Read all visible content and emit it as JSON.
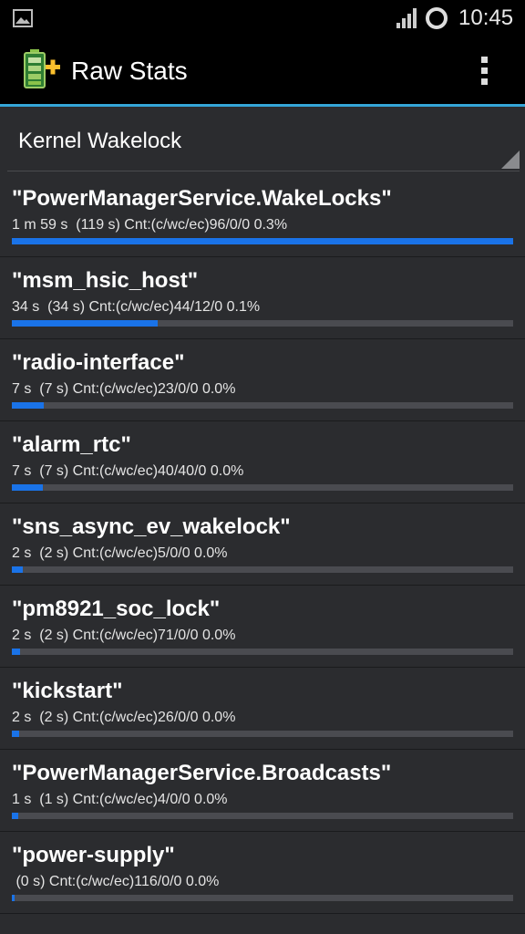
{
  "status_bar": {
    "time": "10:45",
    "icons": [
      "image-notification-icon",
      "signal-icon",
      "sync-ring-icon"
    ]
  },
  "action_bar": {
    "title": "Raw Stats",
    "app_icon": "battery-plus-icon",
    "menu_icon": "overflow-menu-icon"
  },
  "spinner": {
    "selected": "Kernel Wakelock"
  },
  "colors": {
    "accent": "#35a6d8",
    "bar_fill": "#1a73e8",
    "bar_track": "#4a4b50",
    "background": "#2b2c2f"
  },
  "wakelocks": [
    {
      "name": "\"PowerManagerService.WakeLocks\"",
      "detail": "1 m 59 s  (119 s) Cnt:(c/wc/ec)96/0/0 0.3%",
      "progress": 1.0
    },
    {
      "name": "\"msm_hsic_host\"",
      "detail": "34 s  (34 s) Cnt:(c/wc/ec)44/12/0 0.1%",
      "progress": 0.29
    },
    {
      "name": "\"radio-interface\"",
      "detail": "7 s  (7 s) Cnt:(c/wc/ec)23/0/0 0.0%",
      "progress": 0.063
    },
    {
      "name": "\"alarm_rtc\"",
      "detail": "7 s  (7 s) Cnt:(c/wc/ec)40/40/0 0.0%",
      "progress": 0.061
    },
    {
      "name": "\"sns_async_ev_wakelock\"",
      "detail": "2 s  (2 s) Cnt:(c/wc/ec)5/0/0 0.0%",
      "progress": 0.021
    },
    {
      "name": "\"pm8921_soc_lock\"",
      "detail": "2 s  (2 s) Cnt:(c/wc/ec)71/0/0 0.0%",
      "progress": 0.017
    },
    {
      "name": "\"kickstart\"",
      "detail": "2 s  (2 s) Cnt:(c/wc/ec)26/0/0 0.0%",
      "progress": 0.015
    },
    {
      "name": "\"PowerManagerService.Broadcasts\"",
      "detail": "1 s  (1 s) Cnt:(c/wc/ec)4/0/0 0.0%",
      "progress": 0.012
    },
    {
      "name": "\"power-supply\"",
      "detail": " (0 s) Cnt:(c/wc/ec)116/0/0 0.0%",
      "progress": 0.005
    }
  ]
}
